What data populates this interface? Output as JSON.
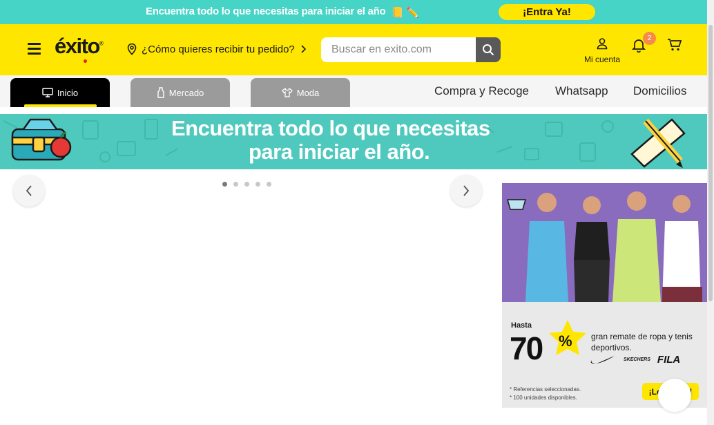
{
  "topbar": {
    "promo_text": "Encuentra todo lo que necesitas para iniciar el año",
    "promo_emoji": "📒 ✏️",
    "cta_label": "¡Entra Ya!"
  },
  "header": {
    "logo_text": "éxito",
    "delivery_label": "¿Cómo quieres recibir tu pedido?",
    "search_placeholder": "Buscar en exito.com",
    "account_label": "Mi cuenta",
    "notification_count": "2",
    "icons": [
      "hamburger-icon",
      "location-pin-icon",
      "chevron-right-icon",
      "search-icon",
      "user-icon",
      "bell-icon",
      "cart-icon"
    ]
  },
  "catnav": {
    "tabs": [
      {
        "label": "Inicio",
        "icon": "monitor-icon"
      },
      {
        "label": "Mercado",
        "icon": "bottle-icon"
      },
      {
        "label": "Moda",
        "icon": "shirt-icon"
      }
    ],
    "links": [
      "Compra y Recoge",
      "Whatsapp",
      "Domicilios"
    ]
  },
  "banner": {
    "line1": "Encuentra todo lo que necesitas",
    "line2": "para iniciar el año."
  },
  "carousel": {
    "slide_count": 5,
    "active_index": 0
  },
  "ad": {
    "hasta": "Hasta",
    "percent": "70",
    "percent_sign": "%",
    "desc": "gran remate de ropa y tenis deportivos.",
    "brands": [
      "SKECHERS",
      "FILA"
    ],
    "note_line1": "* Referencias seleccionadas.",
    "note_line2": "* 100 unidades disponibles.",
    "cta_label": "¡Lo quiero!"
  },
  "colors": {
    "brand_yellow": "#ffe600",
    "teal": "#45d4c6",
    "dark": "#000000",
    "tab_grey": "#9b9b9b",
    "badge_orange": "#f58a4b"
  }
}
